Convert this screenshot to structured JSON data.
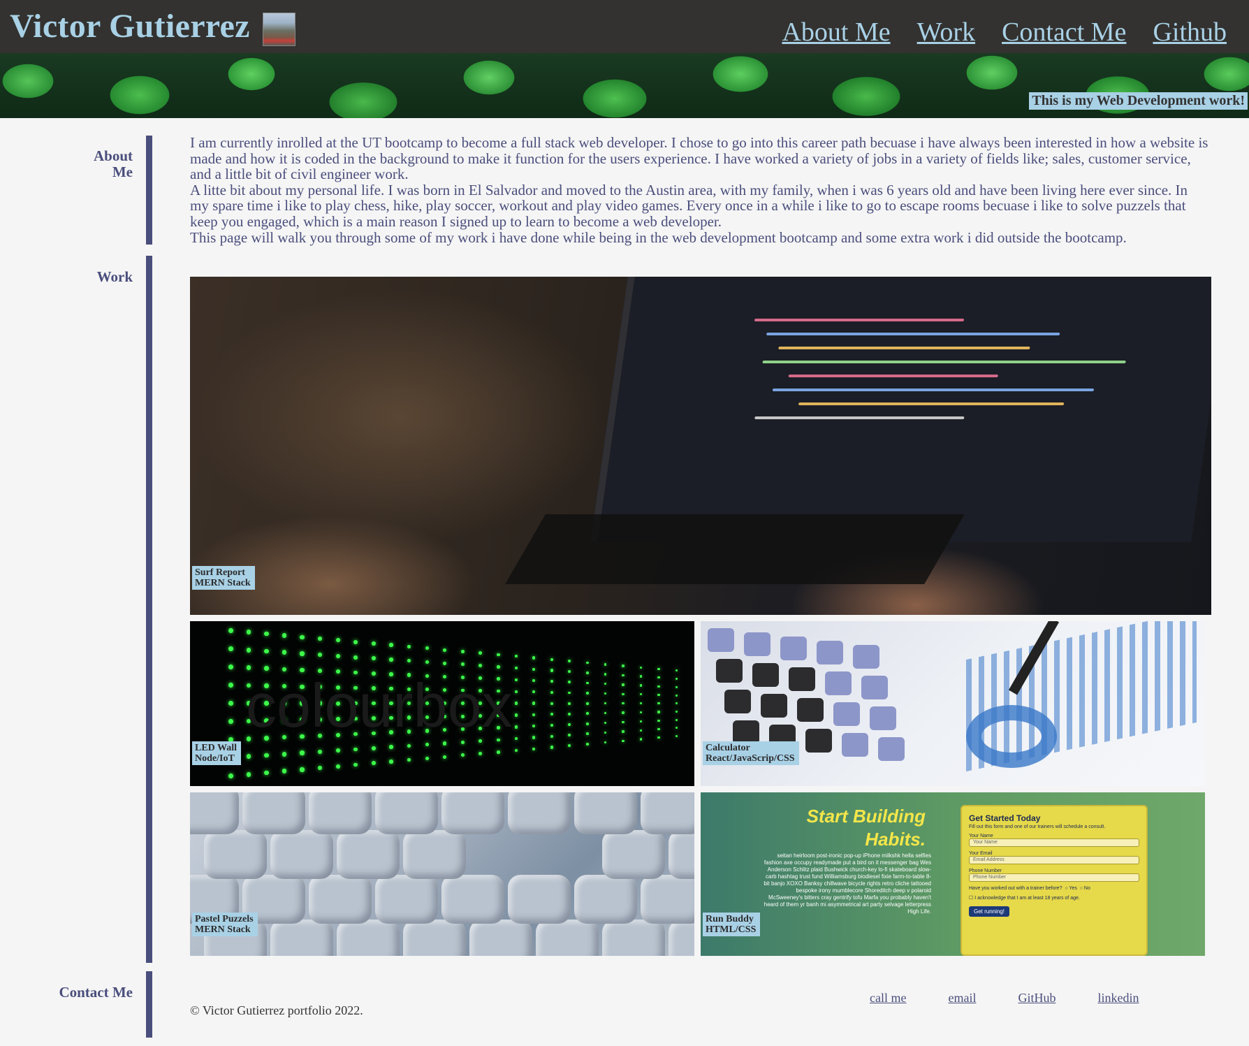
{
  "header": {
    "brand": "Victor Gutierrez",
    "nav": [
      "About Me",
      "Work",
      "Contact Me",
      "Github"
    ]
  },
  "hero": {
    "caption": "This is my Web Development work!"
  },
  "about": {
    "label_line1": "About",
    "label_line2": "Me",
    "paragraphs": [
      "I am currently inrolled at the UT bootcamp to become a full stack web developer. I chose to go into this career path becuase i have always been interested in how a website is made and how it is coded in the background to make it function for the users experience. I have worked a variety of jobs in a variety of fields like; sales, customer service, and a little bit of civil engineer work.",
      "A litte bit about my personal life. I was born in El Salvador and moved to the Austin area, with my family, when i was 6 years old and have been living here ever since. In my spare time i like to play chess, hike, play soccer, workout and play video games. Every once in a while i like to go to escape rooms becuase i like to solve puzzels that keep you engaged, which is a main reason I signed up to learn to become a web developer.",
      "This page will walk you through some of my work i have done while being in the web development bootcamp and some extra work i did outside the bootcamp."
    ]
  },
  "work": {
    "label": "Work",
    "projects": [
      {
        "title": "Surf Report",
        "tech": "MERN Stack"
      },
      {
        "title": "LED Wall",
        "tech": "Node/IoT"
      },
      {
        "title": "Calculator",
        "tech": "React/JavaScrip/CSS"
      },
      {
        "title": "Pastel Puzzels",
        "tech": "MERN Stack"
      },
      {
        "title": "Run Buddy",
        "tech": "HTML/CSS"
      }
    ],
    "led_watermark": "colourbox",
    "run_buddy_preview": {
      "headline_line1": "Start Building",
      "headline_line2": "Habits.",
      "blurb": "seitan heirloom post-ironic pop-up iPhone milkshk hella selfies fashion axe occupy readymade put a bird on it messenger bag Wes Anderson Schlitz plaid Bushwick church-key lo-fi skateboard slow-carb hashtag trust fund Williamsburg biodiesel fixie farm-to-table 8-bit banjo XOXO Banksy chillwave bicycle rights retro cliche tattooed bespoke irony mumblecore Shoreditch deep v polaroid McSweeney's bitters cray gentrify tofu Marfa you probably haven't heard of them yr banh mi asymmetrical art party selvage letterpress High Life.",
      "form_title": "Get Started Today",
      "form_sub": "Fill out this form and one of our trainers will schedule a consult.",
      "name_label": "Your Name",
      "name_placeholder": "Your Name",
      "email_label": "Your Email",
      "email_placeholder": "Email Address",
      "phone_label": "Phone Number",
      "phone_placeholder": "Phone Number",
      "trainer_question": "Have you worked out with a trainer before?",
      "yes": "Yes",
      "no": "No",
      "ack": "I acknowledge that I am at least 18 years of age.",
      "submit": "Get running!"
    }
  },
  "contact": {
    "label": "Contact Me",
    "copyright": "© Victor Gutierrez portfolio 2022.",
    "links": [
      "call me",
      "email",
      "GitHub",
      "linkedin"
    ]
  }
}
